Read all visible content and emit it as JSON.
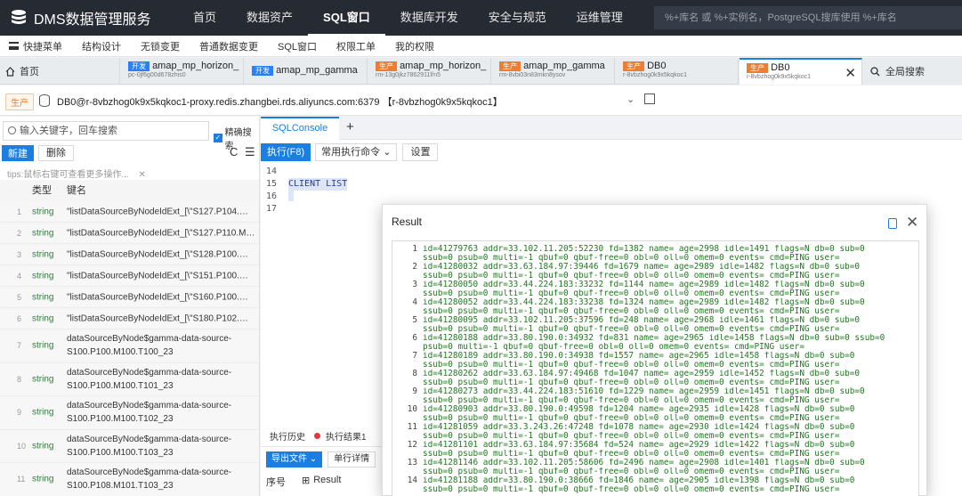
{
  "app": {
    "title": "DMS数据管理服务"
  },
  "topnav": [
    {
      "label": "首页",
      "active": false
    },
    {
      "label": "数据资产",
      "active": false
    },
    {
      "label": "SQL窗口",
      "active": true
    },
    {
      "label": "数据库开发",
      "active": false
    },
    {
      "label": "安全与规范",
      "active": false
    },
    {
      "label": "运维管理",
      "active": false
    }
  ],
  "topsearch": {
    "placeholder": "%+库名 或 %+实例名，PostgreSQL搜库使用 %+库名"
  },
  "menubar": {
    "items": [
      "快捷菜单",
      "结构设计",
      "无锁变更",
      "普通数据变更",
      "SQL窗口",
      "权限工单",
      "我的权限"
    ]
  },
  "tabs": {
    "home": "首页",
    "items": [
      {
        "env": "开发",
        "name": "amap_mp_horizon_",
        "sub": "pc-0jf6g00d678zhis0"
      },
      {
        "env": "开发",
        "name": "amap_mp_gamma",
        "sub": ""
      },
      {
        "env": "生产",
        "name": "amap_mp_horizon_",
        "sub": "rm-13g0jkz7862911f/n5"
      },
      {
        "env": "生产",
        "name": "amap_mp_gamma",
        "sub": "rm-8vbi03n83mkn8ysov"
      },
      {
        "env": "生产",
        "name": "DB0",
        "sub": "r-8vbzhog0k9x5kqkoc1"
      },
      {
        "env": "生产",
        "name": "DB0",
        "sub": "r-8vbzhog0k9x5kqkoc1"
      }
    ],
    "close": "✕",
    "global_search": "全局搜索"
  },
  "conn": {
    "env": "生产",
    "text": "DB0@r-8vbzhog0k9x5kqkoc1-proxy.redis.zhangbei.rds.aliyuncs.com:6379 【r-8vbzhog0k9x5kqkoc1】"
  },
  "left": {
    "search_placeholder": "输入关键字，回车搜索",
    "exact": "精确搜索",
    "new": "新建",
    "delete": "删除",
    "tips": "tips:鼠标右键可查看更多操作...",
    "tips_close": "✕",
    "col_type": "类型",
    "col_key": "键名",
    "rows": [
      {
        "no": "1",
        "type": "string",
        "key": "\"listDataSourceByNodeIdExt_[\\\"S127.P104.M1..."
      },
      {
        "no": "2",
        "type": "string",
        "key": "\"listDataSourceByNodeIdExt_[\\\"S127.P110.M1..."
      },
      {
        "no": "3",
        "type": "string",
        "key": "\"listDataSourceByNodeIdExt_[\\\"S128.P100.M1..."
      },
      {
        "no": "4",
        "type": "string",
        "key": "\"listDataSourceByNodeIdExt_[\\\"S151.P100.M1..."
      },
      {
        "no": "5",
        "type": "string",
        "key": "\"listDataSourceByNodeIdExt_[\\\"S160.P100.M1..."
      },
      {
        "no": "6",
        "type": "string",
        "key": "\"listDataSourceByNodeIdExt_[\\\"S180.P102.M1..."
      },
      {
        "no": "7",
        "type": "string",
        "key": "dataSourceByNode$gamma-data-source-S100.P100.M100.T100_23"
      },
      {
        "no": "8",
        "type": "string",
        "key": "dataSourceByNode$gamma-data-source-S100.P100.M100.T101_23"
      },
      {
        "no": "9",
        "type": "string",
        "key": "dataSourceByNode$gamma-data-source-S100.P100.M100.T102_23"
      },
      {
        "no": "10",
        "type": "string",
        "key": "dataSourceByNode$gamma-data-source-S100.P100.M100.T103_23"
      },
      {
        "no": "11",
        "type": "string",
        "key": "dataSourceByNode$gamma-data-source-S100.P108.M101.T103_23"
      }
    ]
  },
  "editor": {
    "tab": "SQLConsole",
    "plus": "+",
    "exec": "执行(F8)",
    "common_cmd": "常用执行命令",
    "settings": "设置",
    "lines": [
      {
        "no": "14",
        "text": ""
      },
      {
        "no": "15",
        "text": "CLIENT LIST"
      },
      {
        "no": "16",
        "text": ""
      },
      {
        "no": "17",
        "text": ""
      }
    ],
    "history": "执行历史",
    "result1": "执行结果1",
    "export": "导出文件",
    "detail": "单行详情",
    "col_seq": "序号",
    "col_result": "Result"
  },
  "modal": {
    "title": "Result",
    "close": "✕",
    "entries": [
      {
        "n": "1",
        "a": "id=41279763 addr=33.102.11.205:52230 fd=1382 name= age=2998 idle=1491 flags=N db=0 sub=0",
        "b": "ssub=0 psub=0 multi=-1 qbuf=0 qbuf-free=0 obl=0 oll=0 omem=0 events= cmd=PING user="
      },
      {
        "n": "2",
        "a": "id=41280032 addr=33.63.184.97:39446 fd=1679 name= age=2989 idle=1482 flags=N db=0 sub=0",
        "b": "ssub=0 psub=0 multi=-1 qbuf=0 qbuf-free=0 obl=0 oll=0 omem=0 events= cmd=PING user="
      },
      {
        "n": "3",
        "a": "id=41280050 addr=33.44.224.183:33232 fd=1144 name= age=2989 idle=1482 flags=N db=0 sub=0",
        "b": "ssub=0 psub=0 multi=-1 qbuf=0 qbuf-free=0 obl=0 oll=0 omem=0 events= cmd=PING user="
      },
      {
        "n": "4",
        "a": "id=41280052 addr=33.44.224.183:33238 fd=1324 name= age=2989 idle=1482 flags=N db=0 sub=0",
        "b": "ssub=0 psub=0 multi=-1 qbuf=0 qbuf-free=0 obl=0 oll=0 omem=0 events= cmd=PING user="
      },
      {
        "n": "5",
        "a": "id=41280095 addr=33.102.11.205:37596 fd=248 name= age=2968 idle=1461 flags=N db=0 sub=0",
        "b": "ssub=0 psub=0 multi=-1 qbuf=0 qbuf-free=0 obl=0 oll=0 omem=0 events= cmd=PING user="
      },
      {
        "n": "6",
        "a": "id=41280188 addr=33.80.190.0:34932 fd=831 name= age=2965 idle=1458 flags=N db=0 sub=0 ssub=0",
        "b": "psub=0 multi=-1 qbuf=0 qbuf-free=0 obl=0 oll=0 omem=0 events= cmd=PING user="
      },
      {
        "n": "7",
        "a": "id=41280189 addr=33.80.190.0:34938 fd=1557 name= age=2965 idle=1458 flags=N db=0 sub=0",
        "b": "ssub=0 psub=0 multi=-1 qbuf=0 qbuf-free=0 obl=0 oll=0 omem=0 events= cmd=PING user="
      },
      {
        "n": "8",
        "a": "id=41280262 addr=33.63.184.97:49468 fd=1047 name= age=2959 idle=1452 flags=N db=0 sub=0",
        "b": "ssub=0 psub=0 multi=-1 qbuf=0 qbuf-free=0 obl=0 oll=0 omem=0 events= cmd=PING user="
      },
      {
        "n": "9",
        "a": "id=41280273 addr=33.44.224.183:51610 fd=1229 name= age=2959 idle=1451 flags=N db=0 sub=0",
        "b": "ssub=0 psub=0 multi=-1 qbuf=0 qbuf-free=0 obl=0 oll=0 omem=0 events= cmd=PING user="
      },
      {
        "n": "10",
        "a": "id=41280903 addr=33.80.190.0:49598 fd=1204 name= age=2935 idle=1428 flags=N db=0 sub=0",
        "b": "ssub=0 psub=0 multi=-1 qbuf=0 qbuf-free=0 obl=0 oll=0 omem=0 events= cmd=PING user="
      },
      {
        "n": "11",
        "a": "id=41281059 addr=33.3.243.26:47248 fd=1078 name= age=2930 idle=1424 flags=N db=0 sub=0",
        "b": "ssub=0 psub=0 multi=-1 qbuf=0 qbuf-free=0 obl=0 oll=0 omem=0 events= cmd=PING user="
      },
      {
        "n": "12",
        "a": "id=41281101 addr=33.63.184.97:35684 fd=524 name= age=2929 idle=1422 flags=N db=0 sub=0",
        "b": "ssub=0 psub=0 multi=-1 qbuf=0 qbuf-free=0 obl=0 oll=0 omem=0 events= cmd=PING user="
      },
      {
        "n": "13",
        "a": "id=41281146 addr=33.102.11.205:58606 fd=2496 name= age=2908 idle=1401 flags=N db=0 sub=0",
        "b": "ssub=0 psub=0 multi=-1 qbuf=0 qbuf-free=0 obl=0 oll=0 omem=0 events= cmd=PING user="
      },
      {
        "n": "14",
        "a": "id=41281188 addr=33.80.190.0:38666 fd=1846 name= age=2905 idle=1398 flags=N db=0 sub=0",
        "b": "ssub=0 psub=0 multi=-1 qbuf=0 qbuf-free=0 obl=0 oll=0 omem=0 events= cmd=PING user="
      }
    ]
  },
  "colors": {
    "accent": "#1b7ee0",
    "topbar": "#252a33",
    "result_text": "#1f7a1f",
    "env_prod": "#ed7d31",
    "env_dev": "#2a7fff"
  }
}
